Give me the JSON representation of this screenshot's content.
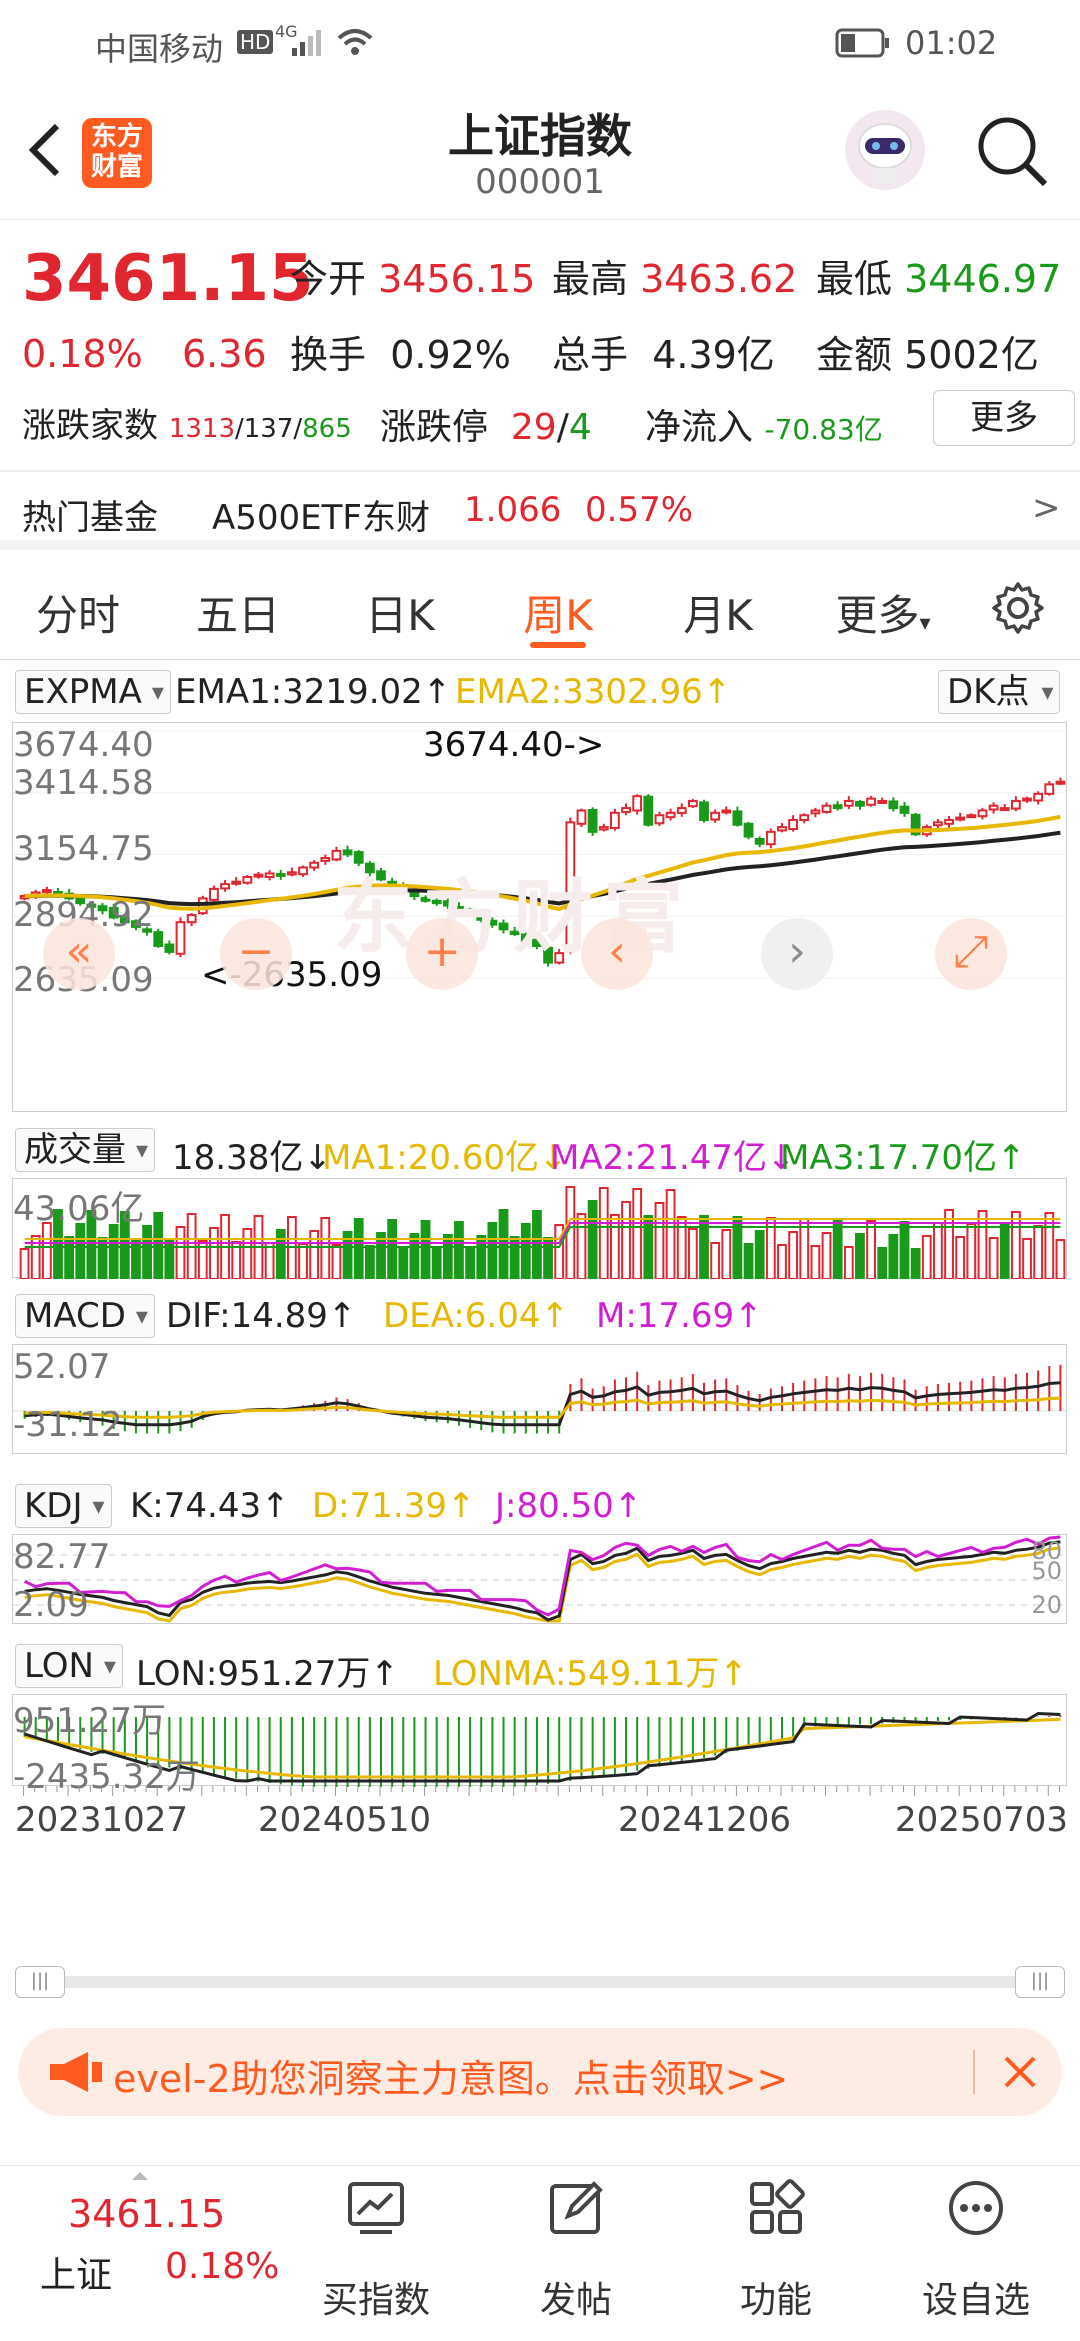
{
  "status": {
    "carrier": "中国移动",
    "hd": "HD",
    "net": "4G",
    "time": "01:02"
  },
  "header": {
    "title": "上证指数",
    "code": "000001",
    "logo_text": "东方\n财富"
  },
  "quote": {
    "price": "3461.15",
    "change_pct": "0.18%",
    "change": "6.36",
    "open_label": "今开",
    "open": "3456.15",
    "high_label": "最高",
    "high": "3463.62",
    "low_label": "最低",
    "low": "3446.97",
    "turnover_label": "换手",
    "turnover": "0.92%",
    "volume_label": "总手",
    "volume": "4.39亿",
    "amount_label": "金额",
    "amount": "5002亿",
    "breadth_label": "涨跌家数",
    "up_count": "1313",
    "flat_count": "/137/",
    "down_count": "865",
    "limit_label": "涨跌停",
    "limit_up": "29",
    "limit_sep": "/",
    "limit_down": "4",
    "inflow_label": "净流入",
    "inflow": "-70.83亿",
    "more_button": "更多",
    "fund_label": "热门基金",
    "fund_name": "A500ETF东财",
    "fund_price": "1.066",
    "fund_pct": "0.57%",
    "fund_arrow": ">"
  },
  "tabs": [
    "分时",
    "五日",
    "日K",
    "周K",
    "月K",
    "更多"
  ],
  "active_tab": "周K",
  "indicators": {
    "expma": {
      "name": "EXPMA",
      "ema1": "EMA1:3219.02↑",
      "ema2": "EMA2:3302.96↑",
      "dk": "DK点"
    },
    "kline_axis": [
      "3674.40",
      "3414.58",
      "3154.75",
      "2894.92",
      "2635.09"
    ],
    "kline_max_label": "3674.40->",
    "kline_min_label": "<-2635.09",
    "watermark": "东方财富",
    "volume": {
      "name": "成交量",
      "val": "18.38亿↓",
      "ma1": "MA1:20.60亿↓",
      "ma2": "MA2:21.47亿↓",
      "ma3": "MA3:17.70亿↑",
      "axis": "43.06亿"
    },
    "macd": {
      "name": "MACD",
      "dif": "DIF:14.89↑",
      "dea": "DEA:6.04↑",
      "m": "M:17.69↑",
      "axis_top": "52.07",
      "axis_bot": "-31.12"
    },
    "kdj": {
      "name": "KDJ",
      "k": "K:74.43↑",
      "d": "D:71.39↑",
      "j": "J:80.50↑",
      "axis_top": "82.77",
      "axis_bot": "2.09",
      "r80": "80",
      "r50": "50",
      "r20": "20"
    },
    "lon": {
      "name": "LON",
      "lon": "LON:951.27万↑",
      "lonma": "LONMA:549.11万↑",
      "axis_top": "951.27万",
      "axis_bot": "-2435.32万"
    },
    "dates": [
      "20231027",
      "20240510",
      "20241206",
      "20250703"
    ]
  },
  "promo": {
    "text": "evel-2助您洞察主力意图。点击领取>>"
  },
  "bottom": {
    "index_price": "3461.15",
    "index_name": "上证",
    "index_pct": "0.18%",
    "nav": [
      "买指数",
      "发帖",
      "功能",
      "设自选"
    ]
  },
  "colors": {
    "up": "#e0262f",
    "down": "#1a9a1a",
    "accent": "#ff5a1f",
    "ema_black": "#222222",
    "ema_gold": "#e6b800",
    "magenta": "#d21ed2"
  },
  "chart_data": {
    "type": "candlestick",
    "ylim": [
      2635.09,
      3674.4
    ],
    "axis_ticks": [
      3674.4,
      3414.58,
      3154.75,
      2894.92,
      2635.09
    ],
    "close": [
      2980,
      2995,
      3005,
      2990,
      2970,
      2950,
      2935,
      2920,
      2890,
      2870,
      2850,
      2830,
      2770,
      2745,
      2870,
      2900,
      2970,
      3010,
      3030,
      3040,
      3060,
      3070,
      3075,
      3065,
      3080,
      3100,
      3120,
      3140,
      3170,
      3155,
      3120,
      3080,
      3050,
      3020,
      3000,
      2980,
      2960,
      2950,
      2940,
      2920,
      2900,
      2880,
      2860,
      2840,
      2820,
      2790,
      2770,
      2700,
      2740,
      3290,
      3340,
      3250,
      3270,
      3330,
      3350,
      3400,
      3280,
      3320,
      3330,
      3350,
      3380,
      3300,
      3330,
      3340,
      3280,
      3230,
      3200,
      3250,
      3270,
      3300,
      3320,
      3340,
      3360,
      3350,
      3380,
      3360,
      3390,
      3380,
      3350,
      3330,
      3240,
      3270,
      3290,
      3300,
      3310,
      3320,
      3340,
      3360,
      3350,
      3380,
      3390,
      3410,
      3450,
      3461
    ]
  }
}
